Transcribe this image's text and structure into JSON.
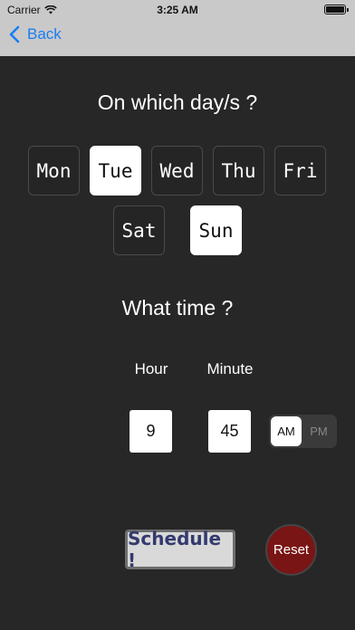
{
  "status": {
    "carrier": "Carrier",
    "time": "3:25 AM"
  },
  "nav": {
    "back_label": "Back"
  },
  "days_heading": "On which day/s ?",
  "days": [
    {
      "label": "Mon",
      "selected": false
    },
    {
      "label": "Tue",
      "selected": true
    },
    {
      "label": "Wed",
      "selected": false
    },
    {
      "label": "Thu",
      "selected": false
    },
    {
      "label": "Fri",
      "selected": false
    },
    {
      "label": "Sat",
      "selected": false
    },
    {
      "label": "Sun",
      "selected": true
    }
  ],
  "time_heading": "What time ?",
  "time": {
    "hour_label": "Hour",
    "minute_label": "Minute",
    "hour_value": "9",
    "minute_value": "45",
    "am_label": "AM",
    "pm_label": "PM",
    "period_selected": "AM"
  },
  "actions": {
    "schedule_label": "Schedule !",
    "reset_label": "Reset"
  },
  "colors": {
    "accent_blue": "#1a7cf5",
    "reset_red": "#7a1515",
    "schedule_text": "#333a6e"
  }
}
